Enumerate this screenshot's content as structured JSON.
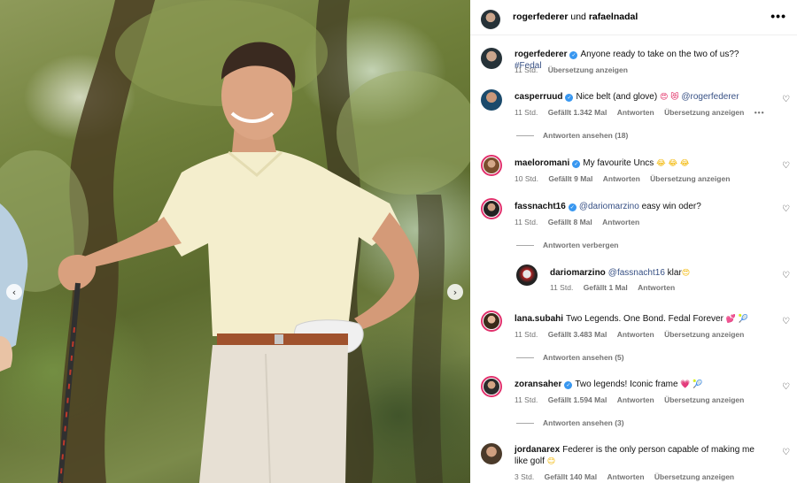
{
  "header": {
    "author": "rogerfederer",
    "joiner": "und",
    "collab": "rafaelnadal"
  },
  "caption": {
    "user": "rogerfederer",
    "text": "Anyone ready to take on the two of us??",
    "hashtag": "#Fedal",
    "time": "11 Std.",
    "translate": "Übersetzung anzeigen"
  },
  "comments": [
    {
      "user": "casperruud",
      "verified": true,
      "text": "Nice belt (and glove)",
      "emoji": "😍 😻",
      "mention": "@rogerfederer",
      "time": "11 Std.",
      "likes": "Gefällt 1.342 Mal",
      "reply": "Antworten",
      "translate": "Übersetzung anzeigen",
      "more": "•••",
      "replies_label": "Antworten ansehen (18)"
    },
    {
      "user": "maeloromani",
      "verified": true,
      "text": "My favourite Uncs",
      "emoji": "😂 😂 😂",
      "time": "10 Std.",
      "likes": "Gefällt 9 Mal",
      "reply": "Antworten",
      "translate": "Übersetzung anzeigen"
    },
    {
      "user": "fassnacht16",
      "verified": true,
      "mention": "@dariomarzino",
      "text": "easy win oder?",
      "time": "11 Std.",
      "likes": "Gefällt 8 Mal",
      "reply": "Antworten",
      "replies_label": "Antworten verbergen"
    },
    {
      "user": "dariomarzino",
      "mention": "@fassnacht16",
      "text": "klar",
      "emoji": "😍",
      "time": "11 Std.",
      "likes": "Gefällt 1 Mal",
      "reply": "Antworten"
    },
    {
      "user": "lana.subahi",
      "text": "Two Legends. One Bond. Fedal Forever",
      "emoji": "💕 🎾",
      "time": "11 Std.",
      "likes": "Gefällt 3.483 Mal",
      "reply": "Antworten",
      "translate": "Übersetzung anzeigen",
      "replies_label": "Antworten ansehen (5)"
    },
    {
      "user": "zoransaher",
      "verified": true,
      "text": "Two legends! Iconic frame",
      "emoji": "💗 🎾",
      "time": "11 Std.",
      "likes": "Gefällt 1.594 Mal",
      "reply": "Antworten",
      "translate": "Übersetzung anzeigen",
      "replies_label": "Antworten ansehen (3)"
    },
    {
      "user": "jordanarex",
      "text": "Federer is the only person capable of making me like golf",
      "emoji": "😊",
      "time": "3 Std.",
      "likes": "Gefällt 140 Mal",
      "reply": "Antworten",
      "translate": "Übersetzung anzeigen"
    }
  ],
  "colors": {
    "link": "#385185",
    "verified": "#3897f0",
    "meta": "#737373"
  },
  "icons": {
    "more": "more-icon",
    "heart": "heart-icon",
    "carousel_prev": "chevron-left-icon",
    "carousel_next": "chevron-right-icon"
  }
}
